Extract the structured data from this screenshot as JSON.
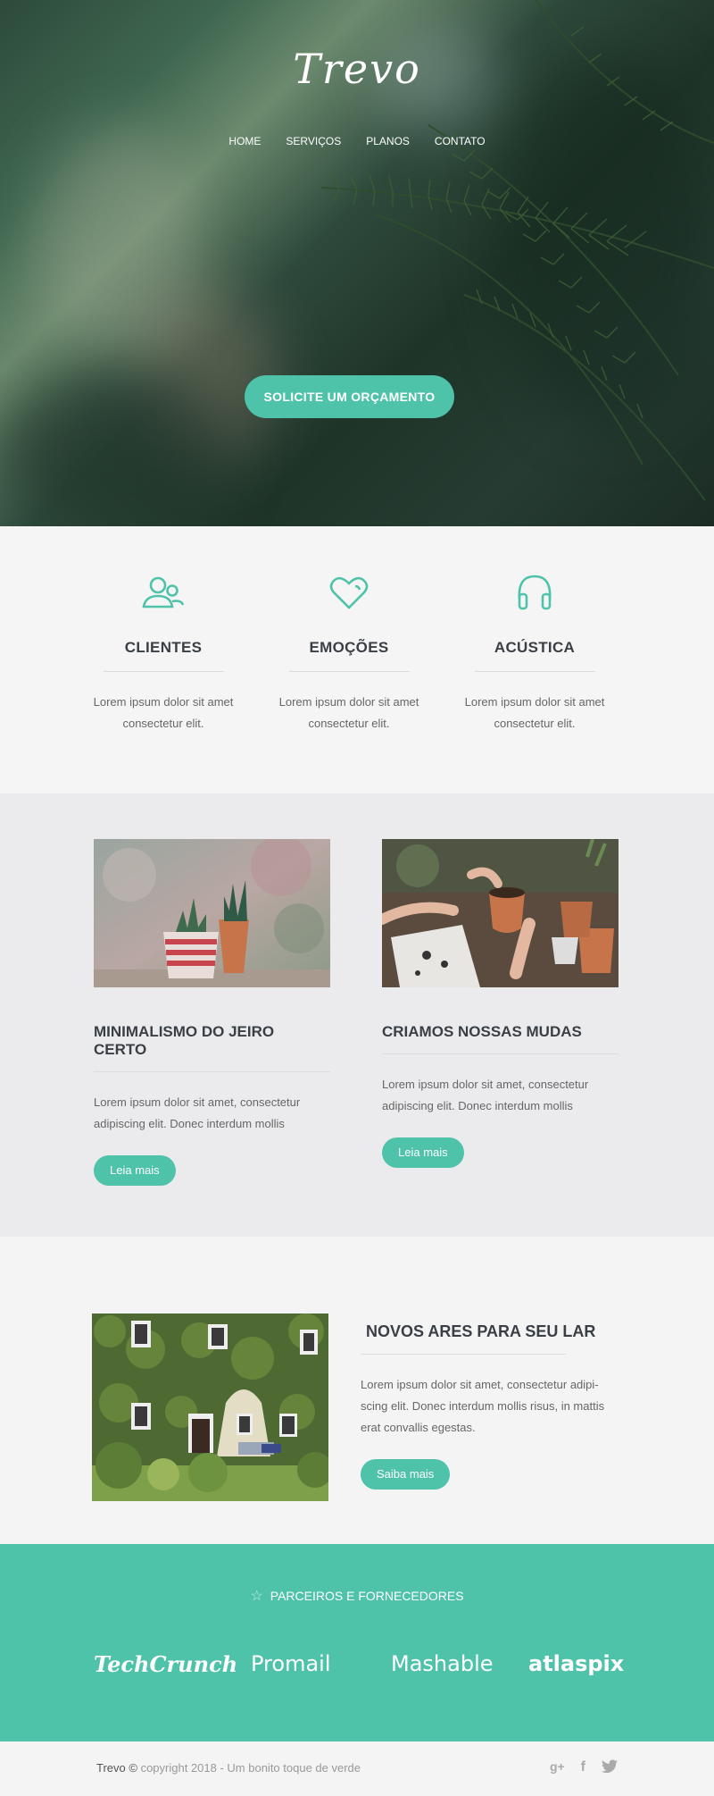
{
  "brand": {
    "logo": "Trevo"
  },
  "nav": [
    "HOME",
    "SERVIÇOS",
    "PLANOS",
    "CONTATO"
  ],
  "hero": {
    "cta": "SOLICITE UM ORÇAMENTO"
  },
  "features": [
    {
      "icon": "users-icon",
      "title": "CLIENTES",
      "text": "Lorem ipsum dolor sit amet consectetur elit."
    },
    {
      "icon": "heart-icon",
      "title": "EMOÇÕES",
      "text": "Lorem ipsum dolor sit amet consectetur elit."
    },
    {
      "icon": "headphones-icon",
      "title": "ACÚSTICA",
      "text": "Lorem ipsum dolor sit amet consectetur elit."
    }
  ],
  "articles": [
    {
      "title": "MINIMALISMO DO JEIRO CERTO",
      "text": "Lorem ipsum dolor sit amet, consectetur adipiscing elit. Donec interdum mollis",
      "button": "Leia mais"
    },
    {
      "title": "CRIAMOS NOSSAS MUDAS",
      "text": "Lorem ipsum dolor sit amet, consectetur adipiscing elit. Donec interdum mollis",
      "button": "Leia mais"
    }
  ],
  "featured": {
    "title": "NOVOS ARES PARA SEU LAR",
    "text": "Lorem ipsum dolor sit amet, consectetur adipi-scing elit. Donec interdum mollis risus, in mattis erat convallis egestas.",
    "button": "Saiba mais"
  },
  "partners": {
    "heading": "PARCEIROS E FORNECEDORES",
    "logos": [
      "TechCrunch",
      "Promail",
      "Mashable",
      "atlaspix"
    ]
  },
  "footer": {
    "brand": "Trevo ©",
    "copyright": "copyright 2018 - Um bonito toque de verde",
    "social": [
      "google-plus-icon",
      "facebook-icon",
      "twitter-icon"
    ]
  },
  "colors": {
    "accent": "#4fc2aa",
    "dark_text": "#3a3f45",
    "body_text": "#666666"
  }
}
